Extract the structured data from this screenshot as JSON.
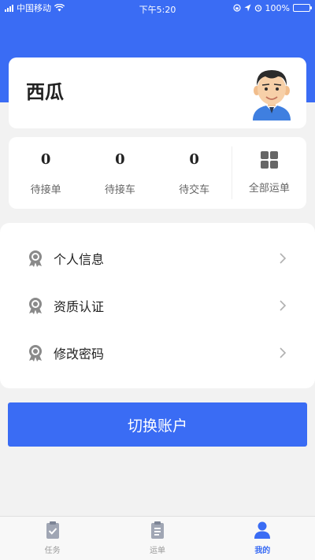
{
  "status_bar": {
    "carrier": "中国移动",
    "time": "下午5:20",
    "battery": "100%"
  },
  "profile": {
    "name": "西瓜"
  },
  "stats": [
    {
      "value": "0",
      "label": "待接单"
    },
    {
      "value": "0",
      "label": "待接车"
    },
    {
      "value": "0",
      "label": "待交车"
    }
  ],
  "all_orders_label": "全部运单",
  "menu": [
    {
      "label": "个人信息"
    },
    {
      "label": "资质认证"
    },
    {
      "label": "修改密码"
    }
  ],
  "switch_account_label": "切换账户",
  "tabs": [
    {
      "label": "任务",
      "icon": "clipboard-check-icon"
    },
    {
      "label": "运单",
      "icon": "clipboard-list-icon"
    },
    {
      "label": "我的",
      "icon": "person-icon",
      "active": true
    }
  ],
  "colors": {
    "primary": "#3a6cf4",
    "background": "#f2f2f2",
    "inactive_tab": "#999999"
  }
}
